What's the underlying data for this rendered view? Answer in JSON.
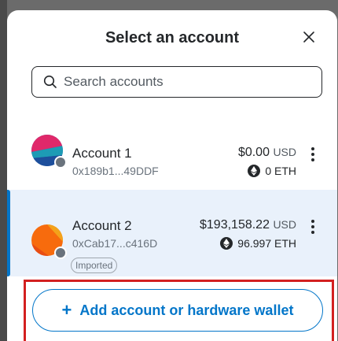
{
  "modal": {
    "title": "Select an account",
    "close_icon": "close-icon"
  },
  "search": {
    "placeholder": "Search accounts",
    "icon": "search-icon"
  },
  "accounts": [
    {
      "name": "Account 1",
      "address": "0x189b1...49DDF",
      "fiat_value": "$0.00",
      "fiat_currency": "USD",
      "eth_value": "0 ETH",
      "selected": false,
      "tag": ""
    },
    {
      "name": "Account 2",
      "address": "0xCab17...c416D",
      "fiat_value": "$193,158.22",
      "fiat_currency": "USD",
      "eth_value": "96.997 ETH",
      "selected": true,
      "tag": "Imported"
    }
  ],
  "footer": {
    "add_label": "Add account or hardware wallet",
    "add_icon": "plus-icon"
  },
  "colors": {
    "accent": "#0376c9",
    "selected_bg": "#e9f1fb",
    "highlight": "#d32020",
    "text": "#24272a",
    "muted": "#6a737d"
  }
}
